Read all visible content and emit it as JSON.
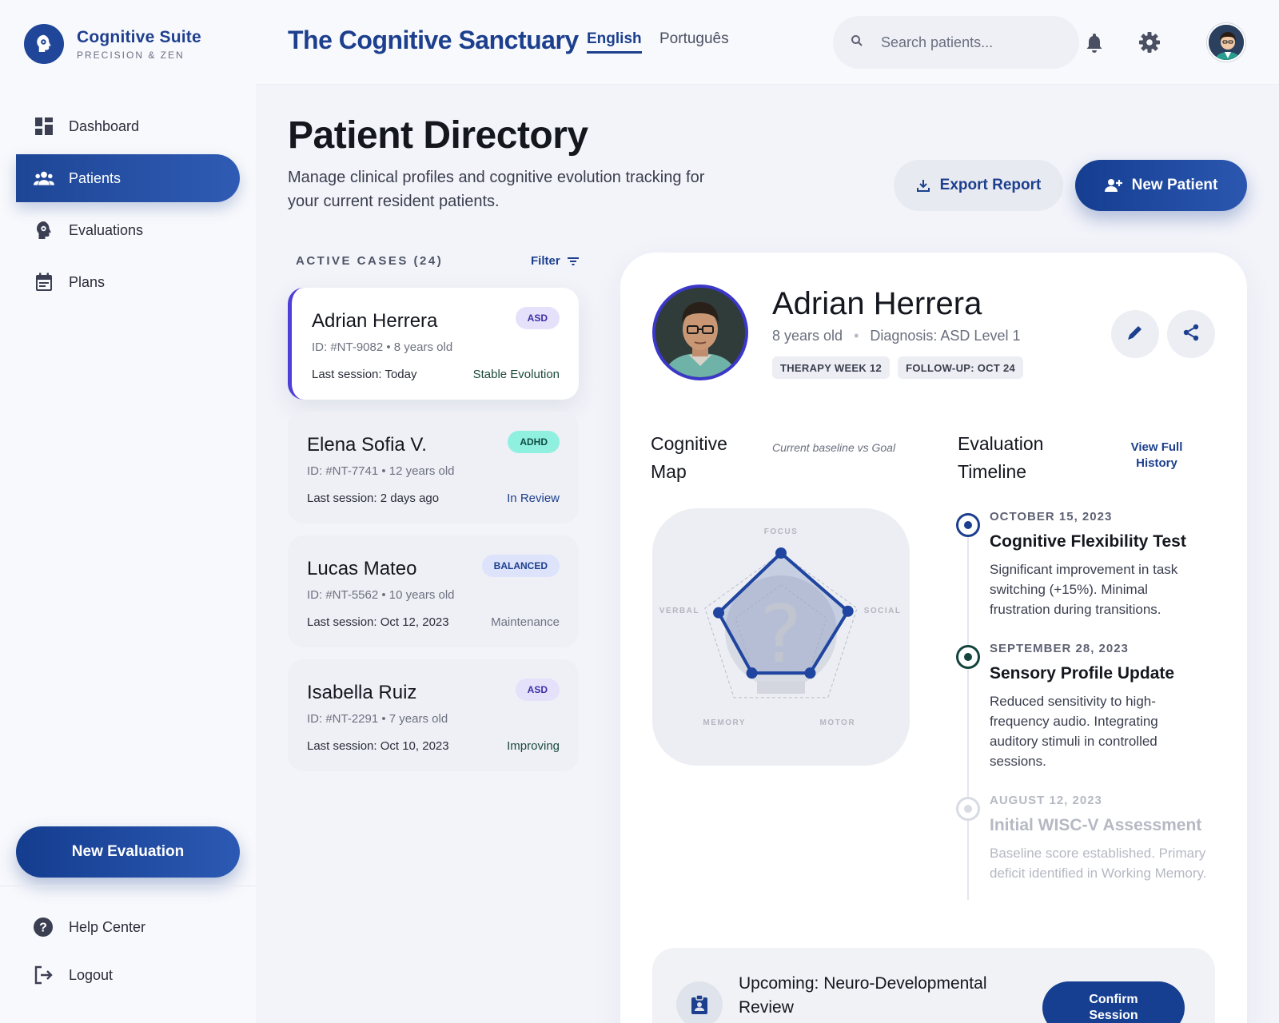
{
  "brand": {
    "name": "Cognitive Suite",
    "tagline": "PRECISION & ZEN"
  },
  "sidebar": {
    "items": [
      {
        "label": "Dashboard",
        "icon": "dashboard-icon",
        "active": false
      },
      {
        "label": "Patients",
        "icon": "patients-icon",
        "active": true
      },
      {
        "label": "Evaluations",
        "icon": "head-gear-icon",
        "active": false
      },
      {
        "label": "Plans",
        "icon": "calendar-icon",
        "active": false
      }
    ],
    "new_evaluation": "New Evaluation",
    "help": "Help Center",
    "logout": "Logout"
  },
  "header": {
    "title": "The Cognitive Sanctuary",
    "lang_en": "English",
    "lang_pt": "Português",
    "search_placeholder": "Search patients..."
  },
  "page": {
    "title": "Patient Directory",
    "subtitle": "Manage clinical profiles and cognitive evolution tracking for your current resident patients.",
    "export": "Export Report",
    "new_patient": "New Patient"
  },
  "cases": {
    "header": "ACTIVE CASES (24)",
    "filter": "Filter",
    "list": [
      {
        "name": "Adrian Herrera",
        "meta": "ID: #NT-9082 • 8 years old",
        "session": "Last session: Today",
        "status": "Stable Evolution",
        "badge": "ASD",
        "status_color": "#1b4a3c",
        "badge_bg": "#e6e1fb",
        "badge_fg": "#3b2fa8"
      },
      {
        "name": "Elena Sofia V.",
        "meta": "ID: #NT-7741 • 12 years old",
        "session": "Last session: 2 days ago",
        "status": "In Review",
        "badge": "ADHD",
        "status_color": "#1c3f8e",
        "badge_bg": "#8ff0e0",
        "badge_fg": "#0f4b42"
      },
      {
        "name": "Lucas Mateo",
        "meta": "ID: #NT-5562 • 10 years old",
        "session": "Last session: Oct 12, 2023",
        "status": "Maintenance",
        "badge": "BALANCED",
        "status_color": "#6d7181",
        "badge_bg": "#dde3fa",
        "badge_fg": "#1c3f8e"
      },
      {
        "name": "Isabella Ruiz",
        "meta": "ID: #NT-2291 • 7 years old",
        "session": "Last session: Oct 10, 2023",
        "status": "Improving",
        "badge": "ASD",
        "status_color": "#1b4a3c",
        "badge_bg": "#e6e1fb",
        "badge_fg": "#3b2fa8"
      }
    ]
  },
  "detail": {
    "name": "Adrian Herrera",
    "age": "8 years old",
    "diagnosis": "Diagnosis: ASD Level 1",
    "tags": [
      "THERAPY WEEK 12",
      "FOLLOW-UP: OCT 24"
    ],
    "cognitive_map_title": "Cognitive Map",
    "cognitive_map_sub": "Current baseline vs Goal",
    "timeline_title": "Evaluation Timeline",
    "timeline_link": "View Full History",
    "timeline": [
      {
        "date": "OCTOBER 15, 2023",
        "title": "Cognitive Flexibility Test",
        "body": "Significant improvement in task switching (+15%). Minimal frustration during transitions."
      },
      {
        "date": "SEPTEMBER 28, 2023",
        "title": "Sensory Profile Update",
        "body": "Reduced sensitivity to high-frequency audio. Integrating auditory stimuli in controlled sessions."
      },
      {
        "date": "AUGUST 12, 2023",
        "title": "Initial WISC-V Assessment",
        "body": "Baseline score established. Primary deficit identified in Working Memory."
      }
    ],
    "upcoming": "Upcoming: Neuro-Developmental Review",
    "confirm": "Confirm Session"
  },
  "radar": {
    "axes": [
      "FOCUS",
      "SOCIAL",
      "MOTOR",
      "MEMORY",
      "VERBAL"
    ],
    "current": [
      1.0,
      0.88,
      0.62,
      0.62,
      0.82
    ]
  },
  "colors": {
    "primary": "#1c3f8e",
    "accent": "#4f3fd8"
  }
}
